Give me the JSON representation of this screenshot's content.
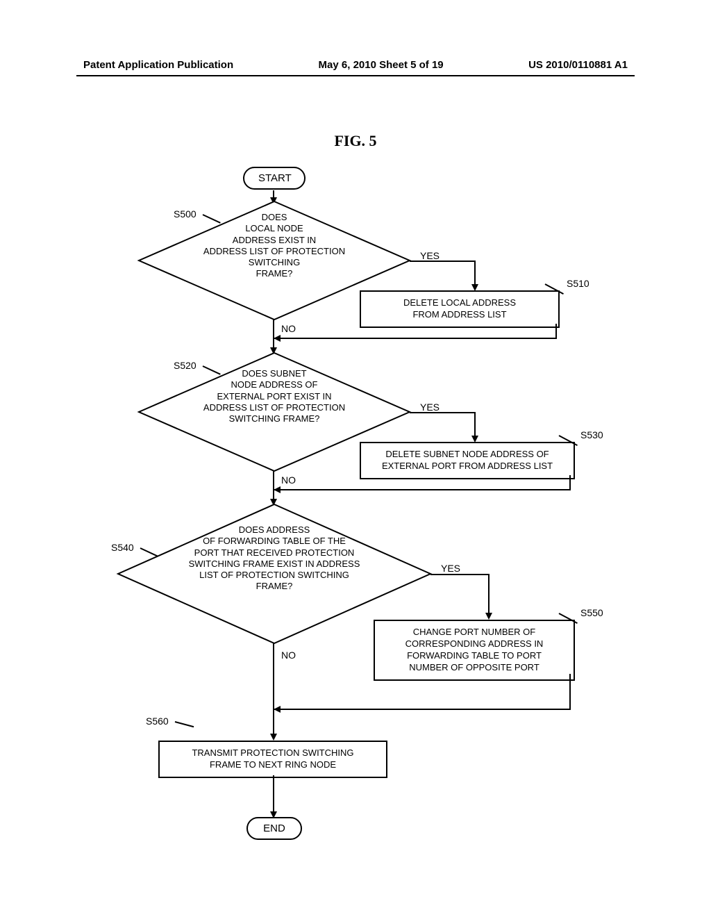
{
  "header": {
    "left": "Patent Application Publication",
    "center": "May 6, 2010  Sheet 5 of 19",
    "right": "US 2010/0110881 A1"
  },
  "figure_title": "FIG.  5",
  "terminals": {
    "start": "START",
    "end": "END"
  },
  "decisions": {
    "d1": "DOES\nLOCAL NODE\nADDRESS EXIST IN\nADDRESS LIST OF PROTECTION\nSWITCHING\nFRAME?",
    "d2": "DOES SUBNET\nNODE ADDRESS OF\nEXTERNAL PORT EXIST IN\nADDRESS LIST OF PROTECTION\nSWITCHING FRAME?",
    "d3": "DOES    ADDRESS\nOF FORWARDING TABLE OF THE\nPORT  THAT RECEIVED PROTECTION\nSWITCHING FRAME EXIST IN ADDRESS\nLIST OF PROTECTION SWITCHING\nFRAME?"
  },
  "processes": {
    "p1": "DELETE LOCAL ADDRESS\nFROM ADDRESS LIST",
    "p2": "DELETE SUBNET NODE ADDRESS OF\nEXTERNAL PORT FROM ADDRESS LIST",
    "p3": "CHANGE PORT NUMBER  OF\nCORRESPONDING ADDRESS IN\nFORWARDING TABLE TO PORT\nNUMBER OF OPPOSITE PORT",
    "p4": "TRANSMIT PROTECTION SWITCHING\nFRAME TO NEXT RING NODE"
  },
  "labels": {
    "yes": "YES",
    "no": "NO"
  },
  "steps": {
    "s500": "S500",
    "s510": "S510",
    "s520": "S520",
    "s530": "S530",
    "s540": "S540",
    "s550": "S550",
    "s560": "S560"
  }
}
